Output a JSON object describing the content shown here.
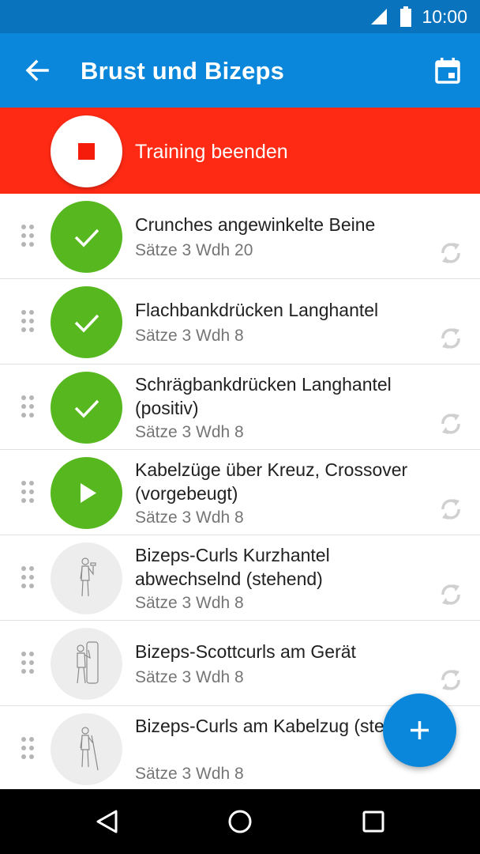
{
  "status_bar": {
    "time": "10:00"
  },
  "app_bar": {
    "title": "Brust und Bizeps",
    "back_icon": "arrow-left-icon",
    "calendar_icon": "calendar-icon"
  },
  "colors": {
    "primary": "#0A87DA",
    "primary_dark": "#0A73BD",
    "stop_red": "#FF2A14",
    "done_green": "#56B81E"
  },
  "end_training": {
    "label": "Training beenden",
    "icon": "stop-icon"
  },
  "exercises": [
    {
      "name": "Crunches angewinkelte Beine",
      "sub": "Sätze 3 Wdh 20",
      "state": "done"
    },
    {
      "name": "Flachbankdrücken Langhantel",
      "sub": "Sätze 3 Wdh 8",
      "state": "done"
    },
    {
      "name": "Schrägbankdrücken Langhantel (positiv)",
      "sub": "Sätze 3 Wdh 8",
      "state": "done"
    },
    {
      "name": "Kabelzüge über Kreuz, Crossover (vorgebeugt)",
      "sub": "Sätze 3 Wdh 8",
      "state": "current"
    },
    {
      "name": "Bizeps-Curls Kurzhantel abwechselnd (stehend)",
      "sub": "Sätze 3 Wdh 8",
      "state": "pending"
    },
    {
      "name": "Bizeps-Scottcurls am Gerät",
      "sub": "Sätze 3 Wdh 8",
      "state": "pending"
    },
    {
      "name": "Bizeps-Curls am Kabelzug (stehend)",
      "sub": "Sätze 3 Wdh 8",
      "state": "pending"
    }
  ],
  "fab": {
    "icon": "plus-icon"
  },
  "nav_bar": {
    "back_icon": "triangle-back-icon",
    "home_icon": "circle-home-icon",
    "recents_icon": "square-recents-icon"
  }
}
